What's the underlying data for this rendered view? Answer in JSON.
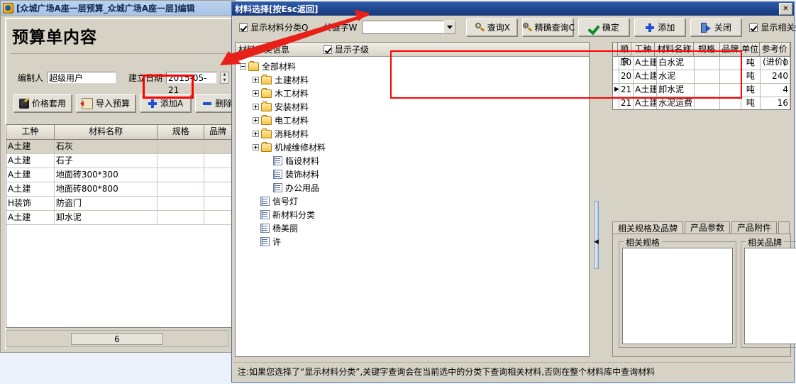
{
  "main_window": {
    "title": "[众城广场A座一层预算_众城广场A座一层]编辑",
    "page_title": "预算单内容",
    "fields": {
      "creator_label": "编制人",
      "creator_value": "超级用户",
      "date_label": "建立日期",
      "date_value": "2015-05-21"
    },
    "buttons": [
      {
        "label": "价格套用",
        "icon": "price-apply-icon"
      },
      {
        "label": "导入预算",
        "icon": "import-budget-icon"
      },
      {
        "label": "添加A",
        "icon": "plus-icon"
      },
      {
        "label": "删除D",
        "icon": "minus-icon"
      }
    ],
    "grid": {
      "columns": [
        "工种",
        "材料名称",
        "规格",
        "品牌"
      ],
      "rows": [
        [
          "A土建",
          "石灰",
          "",
          ""
        ],
        [
          "A土建",
          "石子",
          "",
          ""
        ],
        [
          "A土建",
          "地面砖300*300",
          "",
          ""
        ],
        [
          "A土建",
          "地面砖800*800",
          "",
          ""
        ],
        [
          "H装饰",
          "防盗门",
          "",
          ""
        ],
        [
          "A土建",
          "卸水泥",
          "",
          ""
        ]
      ]
    },
    "footer_count": "6"
  },
  "dialog": {
    "title": "材料选择[按Esc返回]",
    "close_label": "✕",
    "toolbar": {
      "show_category_label": "显示材料分类Q",
      "show_category_checked": true,
      "keyword_label": "关键字W",
      "keyword_value": "",
      "buttons": [
        {
          "label": "查询X",
          "icon": "search-icon"
        },
        {
          "label": "精确查询C",
          "icon": "search-plus-icon"
        },
        {
          "label": "确定",
          "icon": "check-icon"
        },
        {
          "label": "添加",
          "icon": "plus-icon"
        },
        {
          "label": "关闭",
          "icon": "exit-door-icon"
        }
      ],
      "show_related_spec_label": "显示相关规格",
      "show_related_spec_checked": true
    },
    "tree_panel": {
      "header_label": "材料分类信息",
      "show_children_label": "显示子级",
      "show_children_checked": true,
      "nodes": [
        {
          "label": "全部材料",
          "level": 1,
          "icon": "folder-open-icon",
          "expander": "minus"
        },
        {
          "label": "土建材料",
          "level": 2,
          "icon": "folder-icon",
          "expander": "plus"
        },
        {
          "label": "木工材料",
          "level": 2,
          "icon": "folder-icon",
          "expander": "plus"
        },
        {
          "label": "安装材料",
          "level": 2,
          "icon": "folder-icon",
          "expander": "plus"
        },
        {
          "label": "电工材料",
          "level": 2,
          "icon": "folder-icon",
          "expander": "plus"
        },
        {
          "label": "消耗材料",
          "level": 2,
          "icon": "folder-icon",
          "expander": "plus"
        },
        {
          "label": "机械维修材料",
          "level": 2,
          "icon": "folder-icon",
          "expander": "plus"
        },
        {
          "label": "临设材料",
          "level": 3,
          "icon": "document-icon",
          "expander": "none"
        },
        {
          "label": "装饰材料",
          "level": 3,
          "icon": "document-icon",
          "expander": "none"
        },
        {
          "label": "办公用品",
          "level": 3,
          "icon": "document-icon",
          "expander": "none"
        },
        {
          "label": "信号灯",
          "level": 2,
          "icon": "document-icon",
          "expander": "none"
        },
        {
          "label": "新材料分类",
          "level": 2,
          "icon": "document-icon",
          "expander": "none"
        },
        {
          "label": "杨美丽",
          "level": 2,
          "icon": "document-icon",
          "expander": "none"
        },
        {
          "label": "许",
          "level": 2,
          "icon": "document-icon",
          "expander": "none"
        }
      ]
    },
    "result_grid": {
      "columns": [
        "顺序",
        "工种",
        "材料名称",
        "规格",
        "品牌",
        "单位",
        "参考价(进价)"
      ],
      "sort_indicator_column": "顺序",
      "rows": [
        {
          "selected": false,
          "顺序": "10",
          "工种": "A土建",
          "材料名称": "白水泥",
          "规格": "",
          "品牌": "",
          "单位": "吨",
          "参考价": "0"
        },
        {
          "selected": false,
          "顺序": "20",
          "工种": "A土建",
          "材料名称": "水泥",
          "规格": "",
          "品牌": "",
          "单位": "吨",
          "参考价": "240"
        },
        {
          "selected": true,
          "顺序": "21",
          "工种": "A土建",
          "材料名称": "卸水泥",
          "规格": "",
          "品牌": "",
          "单位": "吨",
          "参考价": "4"
        },
        {
          "selected": false,
          "顺序": "21",
          "工种": "A土建",
          "材料名称": "水泥运费",
          "规格": "",
          "品牌": "",
          "单位": "吨",
          "参考价": "16"
        }
      ]
    },
    "tabs": [
      {
        "label": "相关规格及品牌",
        "active": true
      },
      {
        "label": "产品参数",
        "active": false
      },
      {
        "label": "产品附件",
        "active": false
      }
    ],
    "groupboxes": [
      {
        "title": "相关规格",
        "content": ""
      },
      {
        "title": "相关品牌",
        "content": ""
      }
    ],
    "note": "注:如果您选择了“显示材料分类”,关键字查询会在当前选中的分类下查询相关材料,否则在整个材料库中查询材料"
  },
  "colors": {
    "highlight_red": "#ff0000",
    "dialog_title_blue": "#17377a",
    "face": "#d6d2c6"
  }
}
